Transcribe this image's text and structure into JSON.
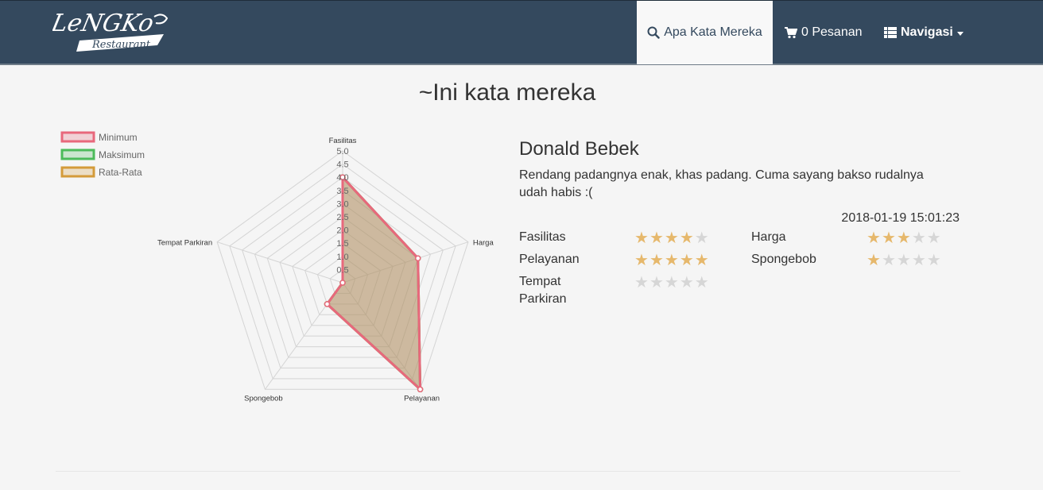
{
  "brand": {
    "name": "Lengko Restaurant"
  },
  "nav": {
    "search_label": "Apa Kata Mereka",
    "cart_label": "0 Pesanan",
    "menu_label": "Navigasi"
  },
  "page": {
    "title": "~Ini kata mereka"
  },
  "review": {
    "name": "Donald Bebek",
    "comment": "Rendang padangnya enak, khas padang. Cuma sayang bakso rudalnya udah habis :(",
    "date": "2018-01-19 15:01:23",
    "ratings": [
      {
        "label": "Fasilitas",
        "value": 4
      },
      {
        "label": "Harga",
        "value": 3
      },
      {
        "label": "Pelayanan",
        "value": 5
      },
      {
        "label": "Spongebob",
        "value": 1
      },
      {
        "label": "Tempat Parkiran",
        "value": 0
      }
    ]
  },
  "chart_data": {
    "type": "radar",
    "categories": [
      "Fasilitas",
      "Harga",
      "Pelayanan",
      "Spongebob",
      "Tempat Parkiran"
    ],
    "tick_labels": [
      "0.5",
      "1.0",
      "1.5",
      "2.0",
      "2.5",
      "3.0",
      "3.5",
      "4.0",
      "4.5",
      "5.0"
    ],
    "range": [
      0,
      5
    ],
    "legend_position": "top-left",
    "series": [
      {
        "name": "Minimum",
        "values": [
          4,
          3,
          5,
          1,
          0
        ],
        "border": "#e8687c",
        "fill": "rgba(232,104,124,0.25)"
      },
      {
        "name": "Maksimum",
        "values": [
          4,
          3,
          5,
          1,
          0
        ],
        "border": "#4cbb5a",
        "fill": "rgba(76,187,90,0.25)"
      },
      {
        "name": "Rata-Rata",
        "values": [
          4,
          3,
          5,
          1,
          0
        ],
        "border": "#d49b3a",
        "fill": "rgba(212,155,58,0.25)"
      }
    ]
  },
  "colors": {
    "navbar": "#34495e",
    "star_on": "#e6b86c",
    "star_off": "#d6d6d6"
  }
}
